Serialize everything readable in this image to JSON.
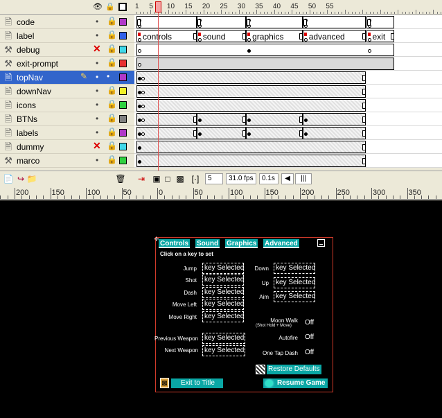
{
  "timeline": {
    "ruler_numbers": [
      "1",
      "5",
      "10",
      "15",
      "20",
      "25",
      "30",
      "35",
      "40",
      "45",
      "50",
      "55"
    ],
    "current_frame": "5",
    "layers": [
      {
        "name": "code",
        "icon": "layer-page-icon",
        "hidden": false,
        "color": "#b038c8",
        "selected": false
      },
      {
        "name": "label",
        "icon": "layer-page-icon",
        "hidden": false,
        "color": "#3060e8",
        "selected": false
      },
      {
        "name": "debug",
        "icon": "guide-icon",
        "hidden": true,
        "color": "#40d8e8",
        "selected": false
      },
      {
        "name": "exit-prompt",
        "icon": "guide-icon",
        "hidden": false,
        "color": "#e83030",
        "selected": false
      },
      {
        "name": "topNav",
        "icon": "layer-page-icon",
        "hidden": false,
        "color": "#b038c8",
        "selected": true
      },
      {
        "name": "downNav",
        "icon": "layer-page-icon",
        "hidden": false,
        "color": "#f0f028",
        "selected": false
      },
      {
        "name": "icons",
        "icon": "layer-page-icon",
        "hidden": false,
        "color": "#30d040",
        "selected": false
      },
      {
        "name": "BTNs",
        "icon": "layer-page-icon",
        "hidden": false,
        "color": "#808080",
        "selected": false
      },
      {
        "name": "labels",
        "icon": "layer-page-icon",
        "hidden": false,
        "color": "#b038c8",
        "selected": false
      },
      {
        "name": "dummy",
        "icon": "layer-page-icon",
        "hidden": true,
        "color": "#40d8e8",
        "selected": false
      },
      {
        "name": "marco",
        "icon": "guide-icon",
        "hidden": false,
        "color": "#30d040",
        "selected": false
      }
    ],
    "frame_labels": [
      "controls",
      "sound",
      "graphics",
      "advanced",
      "exit"
    ],
    "footer": {
      "frame": "5",
      "fps": "31.0 fps",
      "time": "0.1s"
    }
  },
  "stage_ruler": [
    "200",
    "150",
    "100",
    "50",
    "0",
    "50",
    "100",
    "150",
    "200",
    "250",
    "300",
    "350"
  ],
  "panel": {
    "tabs": [
      "Controls",
      "Sound",
      "Graphics",
      "Advanced"
    ],
    "subtitle": "Click on a key to set",
    "left_controls": [
      {
        "label": "Jump",
        "value": "key Selected"
      },
      {
        "label": "Shot",
        "value": "key Selected"
      },
      {
        "label": "Dash",
        "value": "key Selected"
      },
      {
        "label": "Move Left",
        "value": "key Selected"
      },
      {
        "label": "Move Right",
        "value": "key Selected"
      }
    ],
    "right_controls": [
      {
        "label": "Down",
        "value": "key Selected"
      },
      {
        "label": "Up",
        "value": "key Selected"
      },
      {
        "label": "Aim",
        "value": "key Selected"
      }
    ],
    "weapon_controls": [
      {
        "label": "Previous Weapon",
        "value": "key Selected"
      },
      {
        "label": "Next Weapon",
        "value": "key Selected"
      }
    ],
    "toggles": [
      {
        "label": "Moon Walk",
        "note": "(Shot Hold + Move)",
        "value": "Off"
      },
      {
        "label": "Autofire",
        "value": "Off"
      },
      {
        "label": "One Tap Dash",
        "value": "Off"
      }
    ],
    "restore_label": "Restore Defaults",
    "exit_label": "Exit to Title",
    "resume_label": "Resume Game",
    "accent_color": "#0aa7a5",
    "border_color": "#d03a2a"
  }
}
